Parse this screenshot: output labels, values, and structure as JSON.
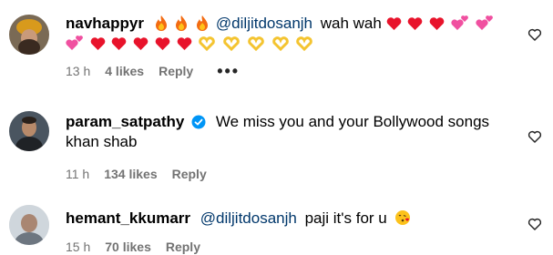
{
  "comments": [
    {
      "username": "navhappyr",
      "mention": "@diljitdosanjh",
      "text": "wah wah",
      "time": "13 h",
      "likes": "4 likes",
      "reply": "Reply",
      "more": "•••"
    },
    {
      "username": "param_satpathy",
      "text_line1": "We miss you and your Bollywood songs",
      "text_line2": "khan shab",
      "time": "11 h",
      "likes": "134 likes",
      "reply": "Reply"
    },
    {
      "username": "hemant_kkumarr",
      "mention": "@diljitdosanjh",
      "text": "paji it's for u",
      "time": "15 h",
      "likes": "70 likes",
      "reply": "Reply"
    }
  ],
  "colors": {
    "mention": "#00376b",
    "meta": "#737373",
    "heart": "#e8132b",
    "verified": "#0095f6"
  },
  "icons": {
    "like_button": "heart-outline-icon",
    "verified": "verified-badge-icon",
    "fire": "fire-emoji",
    "heart": "red-heart-emoji",
    "sparkling_heart": "pink-hearts-emoji",
    "heart_hands": "heart-hands-emoji",
    "kiss": "face-blowing-kiss-emoji"
  }
}
